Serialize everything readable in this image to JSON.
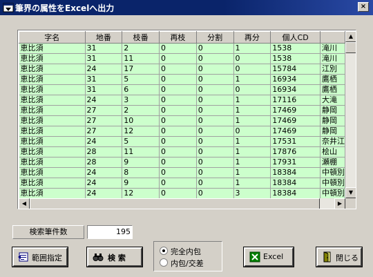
{
  "window": {
    "title": "筆界の属性をExcelへ出力",
    "close_label": "×"
  },
  "grid": {
    "columns": [
      "字名",
      "地番",
      "枝番",
      "再枝",
      "分割",
      "再分",
      "個人CD",
      ""
    ],
    "rows": [
      [
        "恵比須",
        "31",
        "2",
        "0",
        "0",
        "1",
        "1538",
        "滝川"
      ],
      [
        "恵比須",
        "31",
        "11",
        "0",
        "0",
        "0",
        "1538",
        "滝川"
      ],
      [
        "恵比須",
        "24",
        "17",
        "0",
        "0",
        "0",
        "15784",
        "江別"
      ],
      [
        "恵比須",
        "31",
        "5",
        "0",
        "0",
        "1",
        "16934",
        "鷹栖"
      ],
      [
        "恵比須",
        "31",
        "6",
        "0",
        "0",
        "0",
        "16934",
        "鷹栖"
      ],
      [
        "恵比須",
        "24",
        "3",
        "0",
        "0",
        "1",
        "17116",
        "大滝"
      ],
      [
        "恵比須",
        "27",
        "2",
        "0",
        "0",
        "1",
        "17469",
        "静岡"
      ],
      [
        "恵比須",
        "27",
        "10",
        "0",
        "0",
        "1",
        "17469",
        "静岡"
      ],
      [
        "恵比須",
        "27",
        "12",
        "0",
        "0",
        "0",
        "17469",
        "静岡"
      ],
      [
        "恵比須",
        "24",
        "5",
        "0",
        "0",
        "1",
        "17531",
        "奈井江"
      ],
      [
        "恵比須",
        "28",
        "11",
        "0",
        "0",
        "1",
        "17876",
        "桧山"
      ],
      [
        "恵比須",
        "28",
        "9",
        "0",
        "0",
        "1",
        "17931",
        "瀬棚"
      ],
      [
        "恵比須",
        "24",
        "8",
        "0",
        "0",
        "1",
        "18384",
        "中頓別"
      ],
      [
        "恵比須",
        "24",
        "9",
        "0",
        "0",
        "1",
        "18384",
        "中頓別"
      ],
      [
        "恵比須",
        "24",
        "12",
        "0",
        "0",
        "3",
        "18384",
        "中頓別"
      ]
    ]
  },
  "search": {
    "count_label": "検索筆件数",
    "count_value": "195"
  },
  "buttons": {
    "range_label": "範囲指定",
    "search_label": "検 索",
    "excel_label": "Excel",
    "close_label": "閉じる"
  },
  "options": {
    "full_inclusion_label": "完全内包",
    "partial_label": "内包/交差",
    "selected": "full_inclusion"
  },
  "colors": {
    "title_bar": "#0a246a",
    "row_background": "#ccffcc",
    "window_background": "#d4d0c8"
  }
}
